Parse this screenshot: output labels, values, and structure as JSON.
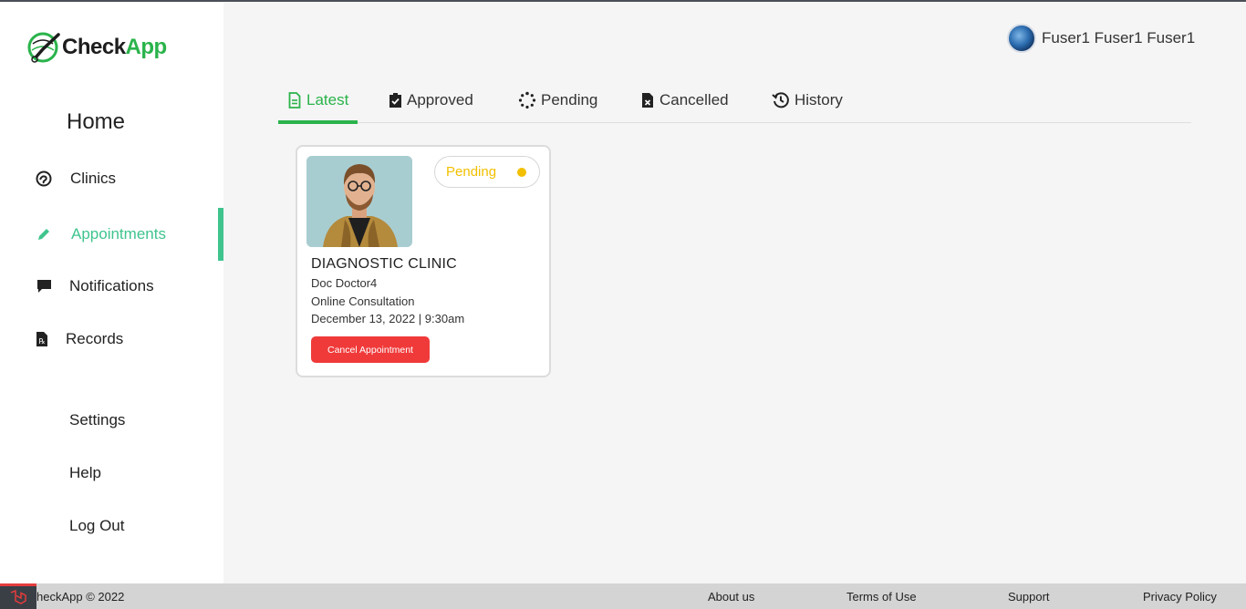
{
  "app": {
    "logo_part1": "Check",
    "logo_part2": "App"
  },
  "sidebar": {
    "home": "Home",
    "items": [
      {
        "label": "Clinics",
        "icon": "clinic-icon",
        "active": false
      },
      {
        "label": "Appointments",
        "icon": "pencil-icon",
        "active": true
      },
      {
        "label": "Notifications",
        "icon": "chat-icon",
        "active": false
      },
      {
        "label": "Records",
        "icon": "prescription-file-icon",
        "active": false
      }
    ],
    "settings": "Settings",
    "help": "Help",
    "logout": "Log Out"
  },
  "user": {
    "name": "Fuser1 Fuser1 Fuser1"
  },
  "tabs": [
    {
      "label": "Latest",
      "icon": "document-icon",
      "active": true
    },
    {
      "label": "Approved",
      "icon": "clipboard-check-icon",
      "active": false
    },
    {
      "label": "Pending",
      "icon": "spinner-icon",
      "active": false
    },
    {
      "label": "Cancelled",
      "icon": "file-x-icon",
      "active": false
    },
    {
      "label": "History",
      "icon": "history-icon",
      "active": false
    }
  ],
  "appointment": {
    "status": "Pending",
    "clinic": "DIAGNOSTIC CLINIC",
    "doctor": "Doc Doctor4",
    "type": "Online Consultation",
    "datetime": "December 13, 2022 | 9:30am",
    "cancel_label": "Cancel Appointment",
    "status_color": "#f2c000"
  },
  "footer": {
    "copyright": "heckApp © 2022",
    "links": [
      "About us",
      "Terms of Use",
      "Support",
      "Privacy Policy"
    ]
  },
  "colors": {
    "accent": "#2ab34b",
    "nav_active": "#3fc48e",
    "danger": "#f03a3a"
  }
}
